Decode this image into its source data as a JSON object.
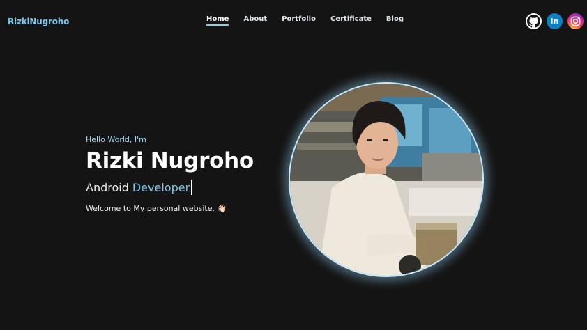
{
  "nav": {
    "brand": "RizkiNugroho",
    "links": [
      "Home",
      "About",
      "Portfolio",
      "Certificate",
      "Blog"
    ],
    "active": "Home"
  },
  "socials": [
    {
      "name": "github",
      "label": "GitHub"
    },
    {
      "name": "linkedin",
      "label": "in"
    },
    {
      "name": "instagram",
      "label": "Instagram"
    }
  ],
  "hero": {
    "greeting": "Hello World, I'm",
    "name": "Rizki Nugroho",
    "role_prefix": "Android",
    "role_highlight": "Developer",
    "welcome": "Welcome to My personal website. 👋🏻"
  },
  "colors": {
    "background": "#141414",
    "accent": "#7fc6ea",
    "glow": "#c5eaff"
  }
}
